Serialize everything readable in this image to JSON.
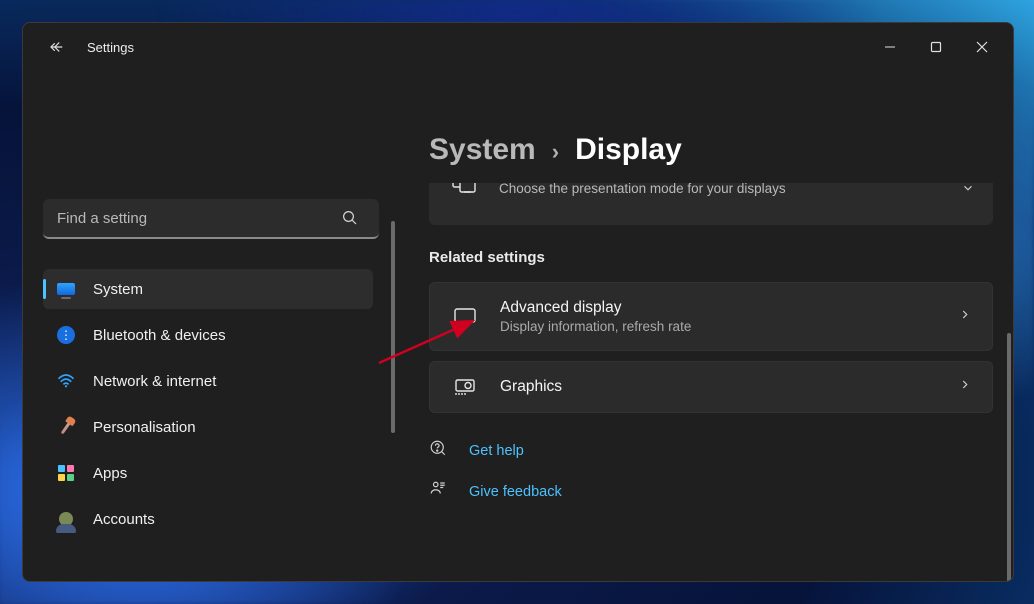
{
  "app_title": "Settings",
  "search": {
    "placeholder": "Find a setting"
  },
  "sidebar": {
    "items": [
      {
        "label": "System"
      },
      {
        "label": "Bluetooth & devices"
      },
      {
        "label": "Network & internet"
      },
      {
        "label": "Personalisation"
      },
      {
        "label": "Apps"
      },
      {
        "label": "Accounts"
      }
    ]
  },
  "breadcrumb": {
    "parent": "System",
    "current": "Display"
  },
  "partial_card": {
    "subtitle": "Choose the presentation mode for your displays"
  },
  "section_header": "Related settings",
  "cards": [
    {
      "title": "Advanced display",
      "subtitle": "Display information, refresh rate"
    },
    {
      "title": "Graphics"
    }
  ],
  "links": {
    "help": "Get help",
    "feedback": "Give feedback"
  }
}
